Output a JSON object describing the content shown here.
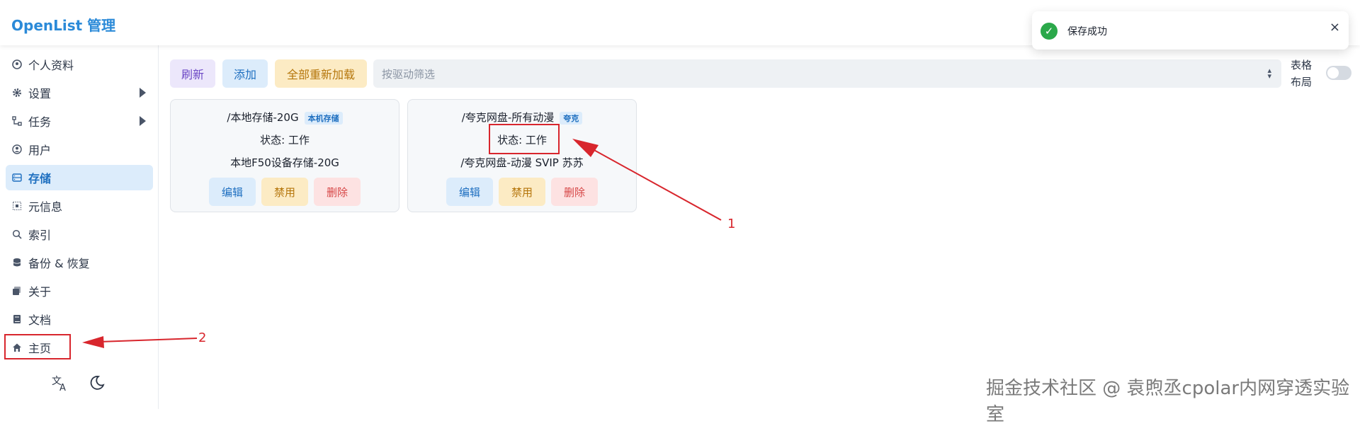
{
  "header": {
    "title": "OpenList 管理"
  },
  "sidebar": {
    "items": [
      {
        "label": "个人资料",
        "icon": "profile-icon"
      },
      {
        "label": "设置",
        "icon": "gear-icon",
        "expandable": true
      },
      {
        "label": "任务",
        "icon": "tasks-icon",
        "expandable": true
      },
      {
        "label": "用户",
        "icon": "user-icon"
      },
      {
        "label": "存储",
        "icon": "storage-icon",
        "active": true
      },
      {
        "label": "元信息",
        "icon": "meta-icon"
      },
      {
        "label": "索引",
        "icon": "search-icon"
      },
      {
        "label": "备份 & 恢复",
        "icon": "database-icon"
      },
      {
        "label": "关于",
        "icon": "about-icon"
      },
      {
        "label": "文档",
        "icon": "book-icon"
      },
      {
        "label": "主页",
        "icon": "home-icon"
      }
    ],
    "bottom_icons": [
      "translate-icon",
      "moon-icon"
    ]
  },
  "toolbar": {
    "refresh": "刷新",
    "add": "添加",
    "reload_all": "全部重新加载",
    "filter_placeholder": "按驱动筛选",
    "table_layout": "表格布局"
  },
  "cards": [
    {
      "path": "/本地存储-20G",
      "tag": "本机存储",
      "status": "状态: 工作",
      "remark": "本地F50设备存储-20G",
      "edit": "编辑",
      "disable": "禁用",
      "delete": "删除"
    },
    {
      "path": "/夸克网盘-所有动漫",
      "tag": "夸克",
      "status": "状态: 工作",
      "remark": "/夸克网盘-动漫 SVIP 苏苏",
      "edit": "编辑",
      "disable": "禁用",
      "delete": "删除"
    }
  ],
  "toast": {
    "message": "保存成功",
    "close": "×"
  },
  "annotations": {
    "one": "1",
    "two": "2"
  },
  "watermark": "掘金技术社区 @ 袁煦丞cpolar内网穿透实验室",
  "colors": {
    "accent": "#2b8ad8",
    "annotation": "#d8262d",
    "success": "#2ba84a"
  }
}
